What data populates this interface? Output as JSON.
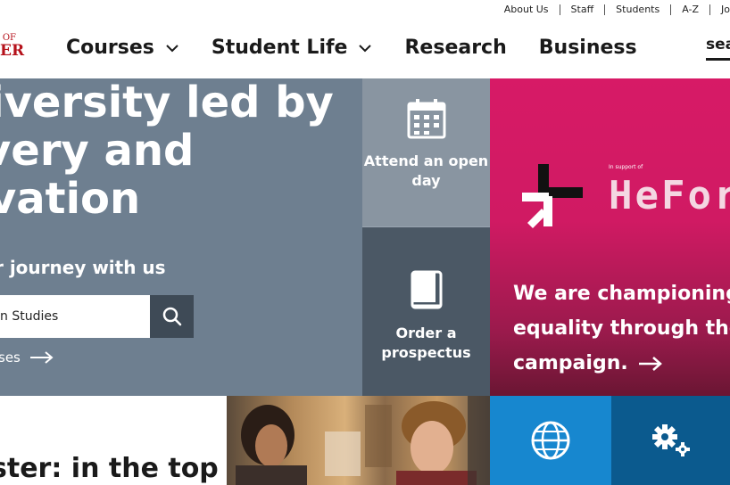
{
  "utility_nav": {
    "links": [
      "About Us",
      "Staff",
      "Students",
      "A-Z",
      "Jo"
    ]
  },
  "logo": {
    "line1": "OF",
    "line2": "ER"
  },
  "main_nav": {
    "items": [
      {
        "label": "Courses",
        "has_dropdown": true
      },
      {
        "label": "Student Life",
        "has_dropdown": true
      },
      {
        "label": "Research",
        "has_dropdown": false
      },
      {
        "label": "Business",
        "has_dropdown": false
      }
    ],
    "search_label": "sea"
  },
  "hero": {
    "title_lines": [
      "niversity led by",
      "overy and",
      "ovation"
    ],
    "subtitle": "r journey with us",
    "search_value": "n Studies",
    "courses_link": "ses"
  },
  "tiles": {
    "open_day": {
      "icon": "calendar-icon",
      "label_lines": [
        "Attend an open",
        "day"
      ]
    },
    "prospectus": {
      "icon": "book-icon",
      "label_lines": [
        "Order a",
        "prospectus"
      ]
    }
  },
  "heforshe": {
    "small_text": "In support of",
    "brand_text": "HeFor",
    "campaign_lines": [
      "We are championing",
      "equality through the",
      "campaign."
    ]
  },
  "bottom": {
    "heading": "ster: in the top"
  },
  "bottom_tiles": {
    "web": {
      "icon": "globe-icon"
    },
    "settings": {
      "icon": "gear-icon"
    }
  },
  "colors": {
    "hero_bg": "#6e7f90",
    "open_day_bg": "#8995a1",
    "prospectus_bg": "#4b5865",
    "heforshe_pink": "#d71a66",
    "web_tile_bg": "#1787cf",
    "settings_tile_bg": "#0b5a8e",
    "logo_red": "#b5121b"
  }
}
